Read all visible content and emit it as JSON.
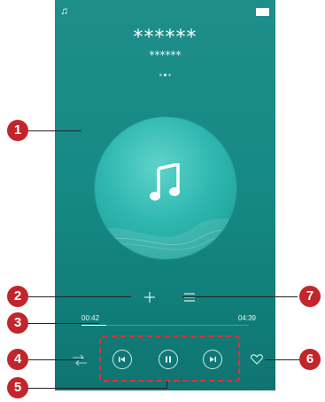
{
  "status": {
    "note_icon": "music-note-icon",
    "battery_icon": "battery-icon"
  },
  "song": {
    "title": "******",
    "artist": "******"
  },
  "page_dots": {
    "count": 3,
    "active": 1
  },
  "album_art": {
    "icon": "music-note-icon"
  },
  "controls": {
    "add_icon": "plus-icon",
    "playlist_icon": "list-icon",
    "shuffle_icon": "shuffle-icon",
    "favorite_icon": "heart-icon"
  },
  "progress": {
    "elapsed": "00:42",
    "total": "04:39",
    "fraction": 0.15
  },
  "playback": {
    "prev_icon": "previous-icon",
    "pause_icon": "pause-icon",
    "next_icon": "next-icon"
  },
  "callouts": {
    "c1": "1",
    "c2": "2",
    "c3": "3",
    "c4": "4",
    "c5": "5",
    "c6": "6",
    "c7": "7"
  },
  "colors": {
    "background": "#168a86",
    "callout": "#c2252b",
    "dashed_box": "#d8343a"
  }
}
